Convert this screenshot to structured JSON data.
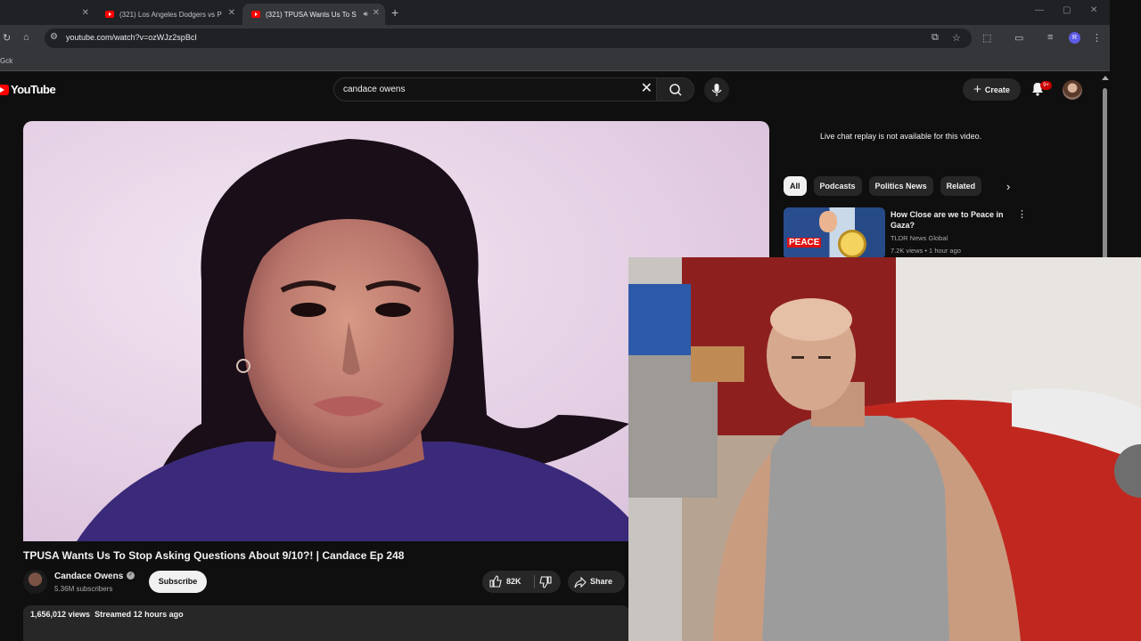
{
  "browser": {
    "tabs": [
      {
        "label": ""
      },
      {
        "label": "(321) Los Angeles Dodgers vs P"
      },
      {
        "label": "(321) TPUSA Wants Us To S"
      }
    ],
    "new_tab": "+",
    "url": "youtube.com/watch?v=ozWJz2spBcI",
    "profile_initial": "R",
    "bookmark": "Gck"
  },
  "youtube": {
    "logo_text": "YouTube",
    "search_value": "candace owens",
    "create_label": "Create",
    "notification_count": "9+"
  },
  "video": {
    "title": "TPUSA Wants Us To Stop Asking Questions About 9/10?! | Candace Ep 248",
    "channel_name": "Candace Owens",
    "subscribers": "5.36M subscribers",
    "subscribe_label": "Subscribe",
    "likes": "82K",
    "share_label": "Share",
    "views": "1,656,012 views",
    "streamed": "Streamed 12 hours ago"
  },
  "sidebar": {
    "chat_note": "Live chat replay is not available for this video.",
    "chips": [
      "All",
      "Podcasts",
      "Politics News",
      "Related"
    ],
    "recommendation": {
      "title": "How Close are we to Peace in Gaza?",
      "channel": "TLDR News Global",
      "meta": "7.2K views • 1 hour ago",
      "thumb_text": "PEACE"
    }
  },
  "icons": [
    "youtube-logo-icon",
    "search-icon",
    "mic-icon",
    "bell-icon",
    "like-icon",
    "dislike-icon",
    "share-icon",
    "verified-icon",
    "chevron-right-icon"
  ],
  "colors": {
    "brand_red": "#ff0000",
    "page_bg": "#0f0f0f",
    "chip_bg": "#272727"
  }
}
